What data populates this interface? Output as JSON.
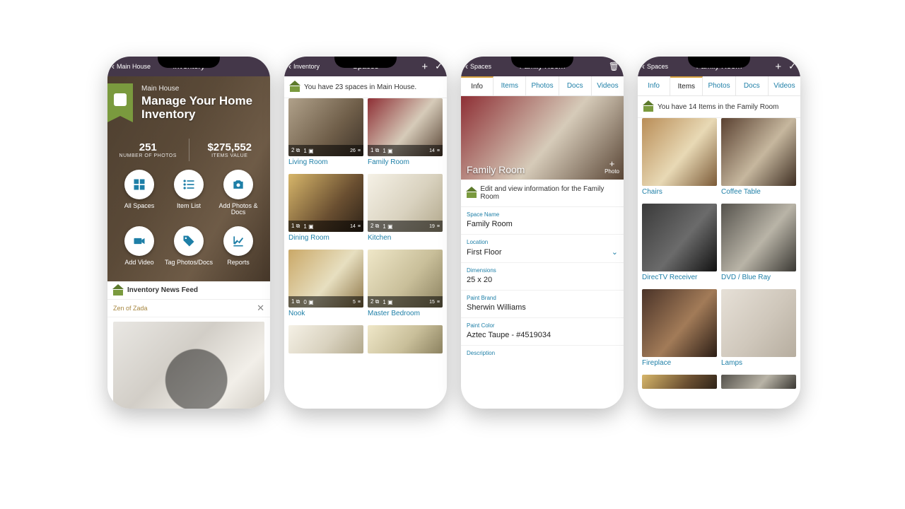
{
  "s1": {
    "back": "Main House",
    "title": "Inventory",
    "hero_sub": "Main House",
    "hero_h1": "Manage Your Home Inventory",
    "stat1_v": "251",
    "stat1_l": "NUMBER OF PHOTOS",
    "stat2_v": "$275,552",
    "stat2_l": "ITEMS VALUE",
    "b_allspaces": "All Spaces",
    "b_itemlist": "Item List",
    "b_addphotos": "Add Photos & Docs",
    "b_addvideo": "Add Video",
    "b_tag": "Tag Photos/Docs",
    "b_reports": "Reports",
    "feed_title": "Inventory News Feed",
    "feed_item": "Zen of Zada"
  },
  "s2": {
    "back": "Inventory",
    "title": "Spaces",
    "msg": "You have 23 spaces in Main House.",
    "cards": [
      {
        "name": "Living Room",
        "p": "2",
        "i": "1",
        "l": "26"
      },
      {
        "name": "Family Room",
        "p": "1",
        "i": "1",
        "l": "14"
      },
      {
        "name": "Dining Room",
        "p": "1",
        "i": "1",
        "l": "14"
      },
      {
        "name": "Kitchen",
        "p": "2",
        "i": "1",
        "l": "19"
      },
      {
        "name": "Nook",
        "p": "1",
        "i": "0",
        "l": "5"
      },
      {
        "name": "Master Bedroom",
        "p": "2",
        "i": "1",
        "l": "15"
      }
    ]
  },
  "s3": {
    "back": "Spaces",
    "title": "Family Room",
    "tabs": [
      "Info",
      "Items",
      "Photos",
      "Docs",
      "Videos"
    ],
    "active_tab": 0,
    "photo_title": "Family Room",
    "addphoto": "Photo",
    "info_msg": "Edit and view information for the Family Room",
    "fields": {
      "space_name_l": "Space Name",
      "space_name_v": "Family Room",
      "location_l": "Location",
      "location_v": "First Floor",
      "dim_l": "Dimensions",
      "dim_v": "25 x 20",
      "paintb_l": "Paint Brand",
      "paintb_v": "Sherwin Williams",
      "paintc_l": "Paint Color",
      "paintc_v": "Aztec Taupe - #4519034",
      "desc_l": "Description"
    }
  },
  "s4": {
    "back": "Spaces",
    "title": "Family Room",
    "tabs": [
      "Info",
      "Items",
      "Photos",
      "Docs",
      "Videos"
    ],
    "active_tab": 1,
    "msg": "You have 14 Items in the Family Room",
    "items": [
      "Chairs",
      "Coffee Table",
      "DirecTV Receiver",
      "DVD / Blue Ray",
      "Fireplace",
      "Lamps"
    ]
  }
}
